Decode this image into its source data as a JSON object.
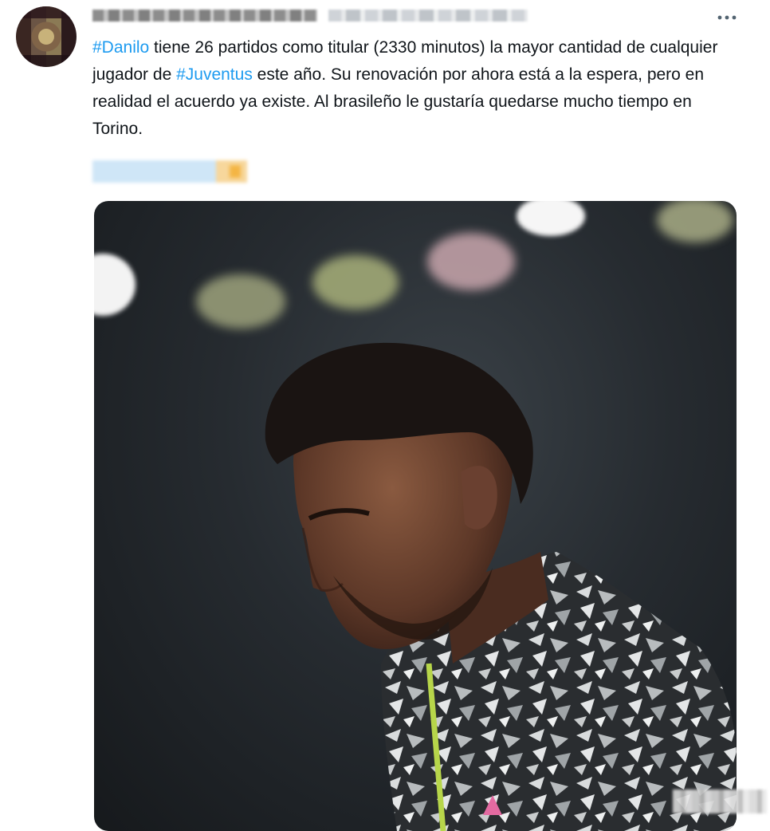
{
  "tweet": {
    "more_icon": "more-horizontal-icon",
    "text": {
      "hashtag_1": "#Danilo",
      "line_part_1": " tiene 26 partidos como titular (2330 minutos) la mayor cantidad de cualquier jugador de ",
      "hashtag_2": "#Juventus",
      "line_part_2": " este año. Su renovación por ahora está a la espera, pero en realidad el acuerdo ya existe. Al brasileño le gustaría quedarse mucho tiempo en Torino."
    },
    "colors": {
      "hashtag": "#1d9bf0",
      "text": "#0f1419",
      "icon": "#536471"
    }
  }
}
